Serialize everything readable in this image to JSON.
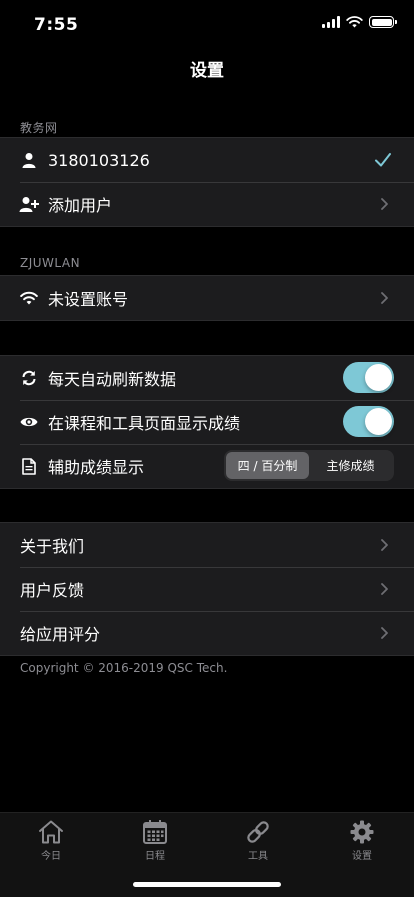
{
  "status_bar": {
    "time": "7:55"
  },
  "nav": {
    "title": "设置"
  },
  "sections": {
    "jwb": {
      "header": "教务网",
      "rows": [
        {
          "label": "3180103126",
          "icon": "user-icon",
          "accessory": "checkmark"
        },
        {
          "label": "添加用户",
          "icon": "add-user-icon",
          "accessory": "chevron"
        }
      ]
    },
    "zjuwlan": {
      "header": "ZJUWLAN",
      "rows": [
        {
          "label": "未设置账号",
          "icon": "wifi-icon",
          "accessory": "chevron"
        }
      ]
    },
    "prefs": {
      "rows": [
        {
          "label": "每天自动刷新数据",
          "icon": "refresh-icon",
          "toggle": true
        },
        {
          "label": "在课程和工具页面显示成绩",
          "icon": "eye-icon",
          "toggle": true
        },
        {
          "label": "辅助成绩显示",
          "icon": "document-icon",
          "segments": [
            "四 / 百分制",
            "主修成绩"
          ],
          "selected_segment": "四 / 百分制"
        }
      ]
    },
    "about": {
      "rows": [
        {
          "label": "关于我们"
        },
        {
          "label": "用户反馈"
        },
        {
          "label": "给应用评分"
        }
      ]
    }
  },
  "footer": {
    "copyright": "Copyright © 2016-2019 QSC Tech."
  },
  "tab_bar": {
    "tabs": [
      {
        "label": "今日",
        "icon": "home-icon"
      },
      {
        "label": "日程",
        "icon": "calendar-icon"
      },
      {
        "label": "工具",
        "icon": "link-icon"
      },
      {
        "label": "设置",
        "icon": "gear-icon",
        "active": true
      }
    ]
  },
  "colors": {
    "accent": "#7ec8d6",
    "background": "#000000",
    "cell": "#1c1c1e",
    "secondary_text": "#8d8d93"
  }
}
